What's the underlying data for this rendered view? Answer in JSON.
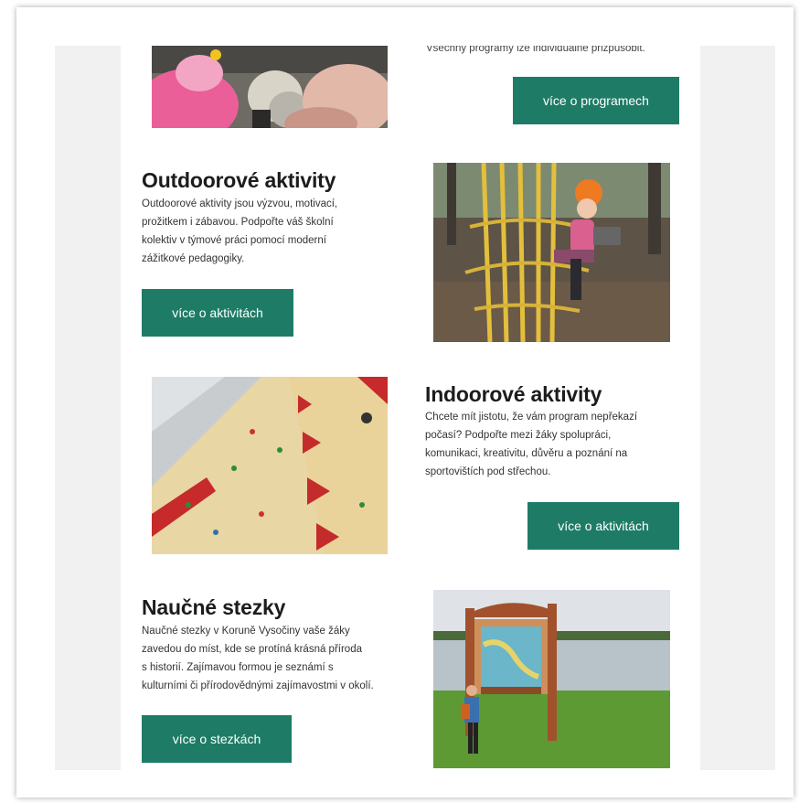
{
  "programs": {
    "partial_text": "Všechny programy lze individuálně přizpůsobit.",
    "button_label": "více o programech"
  },
  "sections": [
    {
      "title": "Outdoorové aktivity",
      "lines": [
        "Outdoorové aktivity jsou výzvou, motivací,",
        "prožitkem i zábavou. Podpořte váš školní",
        "kolektiv v týmové práci pomocí moderní",
        "zážitkové pedagogiky."
      ],
      "button_label": "více o aktivitách"
    },
    {
      "title": "Indoorové aktivity",
      "lines": [
        "Chcete mít jistotu, že vám program nepřekazí",
        "počasí? Podpořte mezi žáky spolupráci,",
        "komunikaci, kreativitu, důvěru a poznání na",
        "sportovištích pod střechou."
      ],
      "button_label": "více o aktivitách"
    },
    {
      "title": "Naučné stezky",
      "lines": [
        "Naučné stezky v Koruně Vysočiny vaše žáky",
        "zavedou do míst, kde se protíná krásná příroda",
        "s historií. Zajímavou formou je seznámí s",
        "kulturními či přírodovědnými zajímavostmi v okolí."
      ],
      "button_label": "více o stezkách"
    }
  ],
  "colors": {
    "button": "#1e7c66",
    "side_panels": "#f1f1f1"
  }
}
